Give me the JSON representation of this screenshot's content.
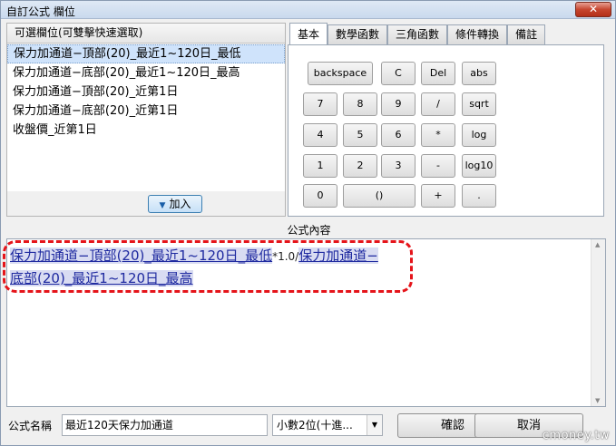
{
  "window": {
    "title": "自訂公式 欄位",
    "close_glyph": "✕"
  },
  "fields_panel": {
    "header": "可選欄位(可雙擊快速選取)",
    "items": [
      "保力加通道−頂部(20)_最近1~120日_最低",
      "保力加通道−底部(20)_最近1~120日_最高",
      "保力加通道−頂部(20)_近第1日",
      "保力加通道−底部(20)_近第1日",
      "收盤價_近第1日"
    ],
    "selected_index": 0,
    "add_button": "加入"
  },
  "tabs": {
    "items": [
      "基本",
      "數學函數",
      "三角函數",
      "條件轉換",
      "備註"
    ],
    "active": "基本"
  },
  "keypad": {
    "row1": [
      "backspace",
      "C",
      "Del",
      "abs"
    ],
    "row2": [
      "7",
      "8",
      "9",
      "/",
      "sqrt"
    ],
    "row3": [
      "4",
      "5",
      "6",
      "*",
      "log"
    ],
    "row4": [
      "1",
      "2",
      "3",
      "-",
      "log10"
    ],
    "row5": [
      "0",
      "()",
      "+",
      "."
    ]
  },
  "formula": {
    "label": "公式內容",
    "token1": "保力加通道−頂部(20)_最近1~120日_最低",
    "operator": "*1.0/",
    "token2a": "保力加通道−",
    "token2b": "底部(20)_最近1~120日_最高"
  },
  "footer": {
    "name_label": "公式名稱",
    "name_value": "最近120天保力加通道",
    "decimal_select": "小數2位(十進...",
    "ok_button": "確認",
    "cancel_button": "取消"
  },
  "watermark": "cmoney.tw",
  "colors": {
    "highlight": "#e5141a",
    "token": "#1f2aa0",
    "selected": "#cfe3fb"
  }
}
